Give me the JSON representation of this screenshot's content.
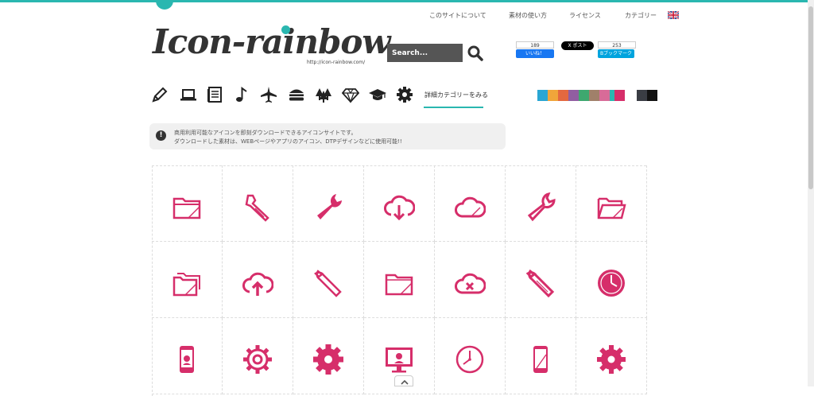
{
  "header": {
    "nav": [
      "このサイトについて",
      "素材の使い方",
      "ライセンス",
      "カテゴリー"
    ],
    "logo_text": "Icon-rainbow",
    "logo_url": "http://icon-rainbow.com/",
    "search_placeholder": "Search...",
    "social": {
      "fb_count": "189",
      "fb_label": "いいね！",
      "x_label": "X ポスト",
      "hatena_count": "253",
      "hatena_label": "Bブックマーク"
    }
  },
  "categories": {
    "icons": [
      "pencil-icon",
      "laptop-icon",
      "document-icon",
      "music-note-icon",
      "airplane-icon",
      "burger-icon",
      "trees-icon",
      "diamond-icon",
      "graduation-cap-icon",
      "gear-icon"
    ],
    "detail_link": "詳細カテゴリーをみる",
    "colors": [
      "#29a6d3",
      "#f0a53a",
      "#e4683f",
      "#915ea1",
      "#3ea86f",
      "#a0806a",
      "#d86b98",
      "#2ab7b0",
      "#d62e6a"
    ],
    "mono_colors": [
      "#3a3d44",
      "#111111"
    ]
  },
  "notice": {
    "line1": "商用利用可能なアイコンを即刻ダウンロードできるアイコンサイトです。",
    "line2": "ダウンロードした素材は、WEBページやアプリのアイコン、DTPデザインなどに使用可能!!"
  },
  "icon_color": "#d62e6a",
  "grid": {
    "rows": [
      [
        "folder-icon",
        "adjustable-wrench-icon",
        "wrench-icon",
        "cloud-download-icon",
        "cloud-icon",
        "wrench-outline-icon",
        "open-folder-icon"
      ],
      [
        "folders-icon",
        "cloud-upload-icon",
        "wrench-tool-icon",
        "folder-outline-icon",
        "cloud-error-icon",
        "spanner-icon",
        "clock-icon"
      ],
      [
        "smartphone-icon",
        "gear-outline-icon",
        "gear-icon",
        "monitor-icon",
        "clock-outline-icon",
        "mobile-phone-icon",
        "cog-icon"
      ]
    ]
  }
}
